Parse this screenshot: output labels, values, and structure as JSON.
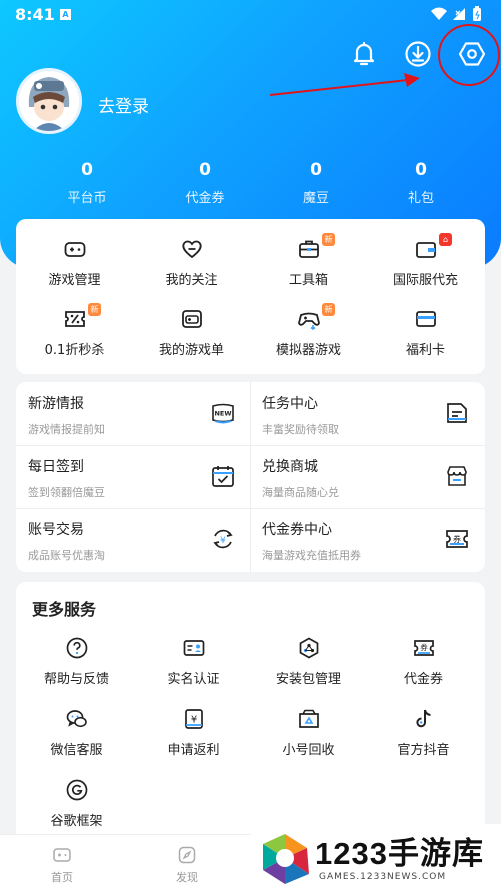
{
  "status_bar": {
    "time": "8:41",
    "sim_label": "A"
  },
  "header": {
    "icons": [
      "bell-icon",
      "download-icon",
      "settings-icon"
    ],
    "login_label": "去登录",
    "stats": [
      {
        "value": "0",
        "label": "平台币"
      },
      {
        "value": "0",
        "label": "代金券"
      },
      {
        "value": "0",
        "label": "魔豆"
      },
      {
        "value": "0",
        "label": "礼包"
      }
    ]
  },
  "quick_grid": [
    {
      "label": "游戏管理",
      "icon": "gamepad-icon"
    },
    {
      "label": "我的关注",
      "icon": "heart-icon"
    },
    {
      "label": "工具箱",
      "icon": "toolbox-icon",
      "badge": "新"
    },
    {
      "label": "国际服代充",
      "icon": "wallet-icon",
      "badge": "hot"
    },
    {
      "label": "0.1折秒杀",
      "icon": "discount-icon",
      "badge": "新"
    },
    {
      "label": "我的游戏单",
      "icon": "game-list-icon"
    },
    {
      "label": "模拟器游戏",
      "icon": "emulator-icon",
      "badge": "新"
    },
    {
      "label": "福利卡",
      "icon": "card-icon"
    }
  ],
  "services": [
    {
      "title": "新游情报",
      "subtitle": "游戏情报提前知",
      "icon": "new-badge-icon"
    },
    {
      "title": "任务中心",
      "subtitle": "丰富奖励待领取",
      "icon": "task-icon"
    },
    {
      "title": "每日签到",
      "subtitle": "签到领翻倍魔豆",
      "icon": "calendar-icon"
    },
    {
      "title": "兑换商城",
      "subtitle": "海量商品随心兑",
      "icon": "shop-icon"
    },
    {
      "title": "账号交易",
      "subtitle": "成品账号优惠淘",
      "icon": "exchange-icon"
    },
    {
      "title": "代金券中心",
      "subtitle": "海量游戏充值抵用券",
      "icon": "coupon-icon"
    }
  ],
  "more": {
    "title": "更多服务",
    "items": [
      {
        "label": "帮助与反馈",
        "icon": "help-icon"
      },
      {
        "label": "实名认证",
        "icon": "id-card-icon"
      },
      {
        "label": "安装包管理",
        "icon": "package-icon"
      },
      {
        "label": "代金券",
        "icon": "voucher-icon"
      },
      {
        "label": "微信客服",
        "icon": "wechat-icon"
      },
      {
        "label": "申请返利",
        "icon": "rebate-icon"
      },
      {
        "label": "小号回收",
        "icon": "recycle-icon"
      },
      {
        "label": "官方抖音",
        "icon": "tiktok-icon"
      },
      {
        "label": "谷歌框架",
        "icon": "google-icon"
      }
    ]
  },
  "tabbar": [
    {
      "label": "首页",
      "icon": "home-icon"
    },
    {
      "label": "发现",
      "icon": "discover-icon"
    }
  ],
  "watermark": {
    "brand": "1233手游库",
    "url": "GAMES.1233NEWS.COM"
  },
  "colors": {
    "header_start": "#0ec8ff",
    "header_end": "#0a7bff",
    "annotation_red": "#e0151b",
    "badge_orange": "#ff8a3d",
    "badge_red": "#f2362a"
  }
}
